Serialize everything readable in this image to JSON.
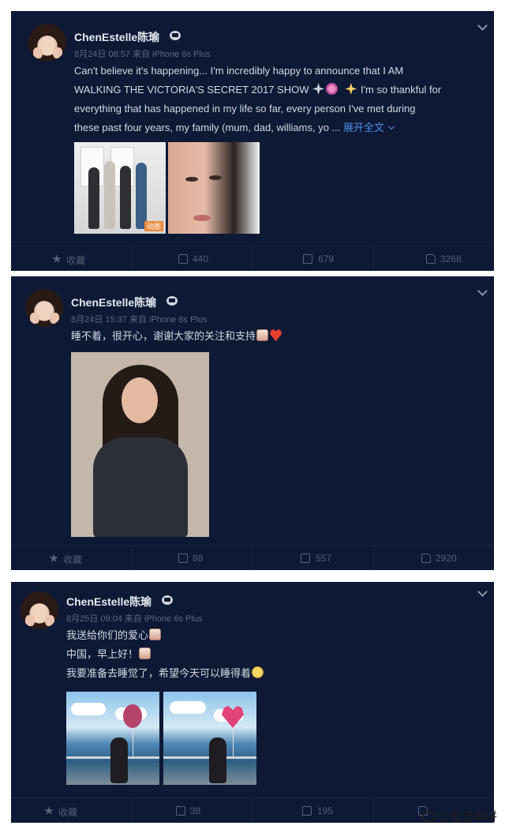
{
  "posts": [
    {
      "username": "ChenEstelle陈瑜",
      "meta": "8月24日 06:57 来自 iPhone 6s Plus",
      "lines": [
        "Can't believe it's happening... I'm incredibly happy to announce that I AM",
        "WALKING THE VICTORIA'S SECRET 2017 SHOW",
        "I'm so thankful for",
        "everything that has happened in my life so far, every person I've met during",
        "these past four years, my family (mum, dad, williams, yo ..."
      ],
      "expand_label": "展开全文",
      "photo_tag": "动图",
      "actions": {
        "favorite": "收藏",
        "repost": "440",
        "comment": "679",
        "like": "3268"
      }
    },
    {
      "username": "ChenEstelle陈瑜",
      "meta": "8月24日 15:37 来自 iPhone 6s Plus",
      "lines": [
        "睡不着，很开心，谢谢大家的关注和支持"
      ],
      "actions": {
        "favorite": "收藏",
        "repost": "88",
        "comment": "557",
        "like": "2920"
      }
    },
    {
      "username": "ChenEstelle陈瑜",
      "meta": "8月25日 09:04 来自 iPhone 6s Plus",
      "lines": [
        "我送给你们的爱心",
        "中国，早上好！",
        "我要准备去睡觉了，希望今天可以睡得着"
      ],
      "actions": {
        "favorite": "收藏",
        "repost": "38",
        "comment": "195",
        "like": ""
      }
    }
  ],
  "watermark": "@憨混嘶拼",
  "icons": [
    "more-chevron-icon",
    "verified-crown-icon",
    "star-icon",
    "repost-icon",
    "comment-icon",
    "like-icon"
  ],
  "colors": {
    "card_bg": "#0e1936",
    "link": "#4a8fe6",
    "text": "#d3d8e2",
    "muted": "#5d6784"
  }
}
